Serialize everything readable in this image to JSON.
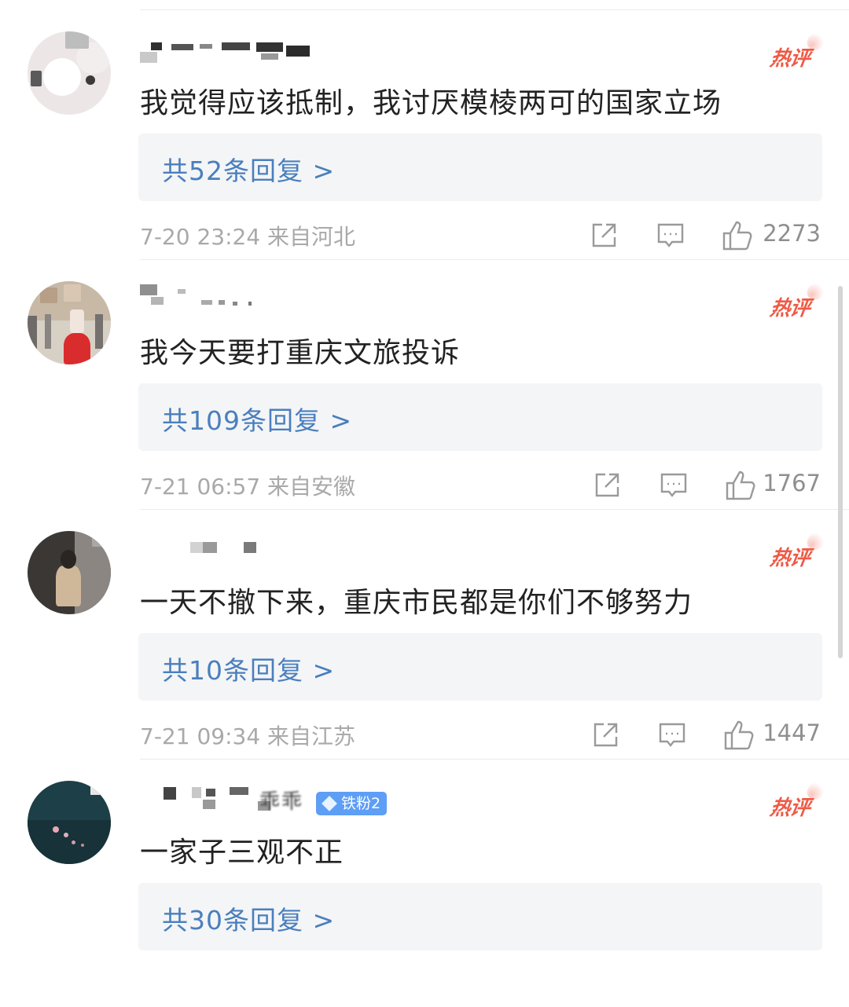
{
  "comments": [
    {
      "text": "我觉得应该抵制，我讨厌模棱两可的国家立场",
      "hot_label": "热评",
      "replies": "共52条回复 >",
      "time": "7-20 23:24 来自河北",
      "likes": "2273"
    },
    {
      "text": "我今天要打重庆文旅投诉",
      "hot_label": "热评",
      "replies": "共109条回复 >",
      "time": "7-21 06:57 来自安徽",
      "likes": "1767"
    },
    {
      "text": "一天不撤下来，重庆市民都是你们不够努力",
      "hot_label": "热评",
      "replies": "共10条回复 >",
      "time": "7-21 09:34 来自江苏",
      "likes": "1447"
    },
    {
      "text": "一家子三观不正",
      "hot_label": "热评",
      "replies": "共30条回复 >",
      "username_visible": "乖乖",
      "fan_badge": "铁粉2"
    }
  ],
  "colors": {
    "hot": "#ef5a46",
    "reply_link": "#4a7fbd",
    "fan_badge": "#5e9ef5"
  },
  "icons": [
    "share-icon",
    "comment-icon",
    "like-icon"
  ]
}
